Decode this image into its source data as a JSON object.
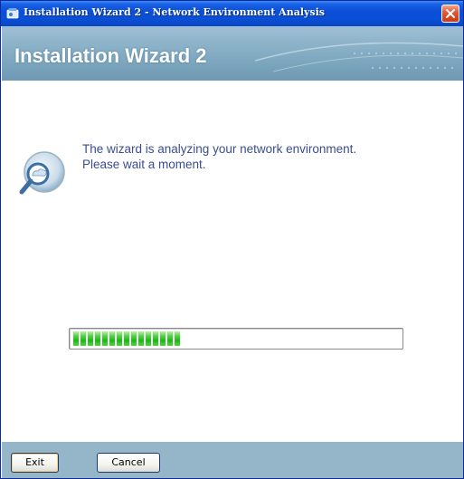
{
  "window": {
    "title": "Installation Wizard 2 - Network Environment Analysis",
    "app_icon": "wizard-app-icon",
    "close_icon": "close-icon"
  },
  "banner": {
    "heading": "Installation Wizard 2"
  },
  "content": {
    "icon": "network-analysis-magnifier-icon",
    "message_line1": "The wizard is analyzing your network environment.",
    "message_line2": "Please wait a moment."
  },
  "progress": {
    "segments_filled": 15,
    "fraction": 0.35,
    "color": "#21b515"
  },
  "footer": {
    "exit_label": "Exit",
    "cancel_label": "Cancel"
  },
  "colors": {
    "titlebar": "#0a4fd6",
    "banner": "#86aec5",
    "footer": "#94b6c8",
    "message_text": "#3a4d92"
  }
}
